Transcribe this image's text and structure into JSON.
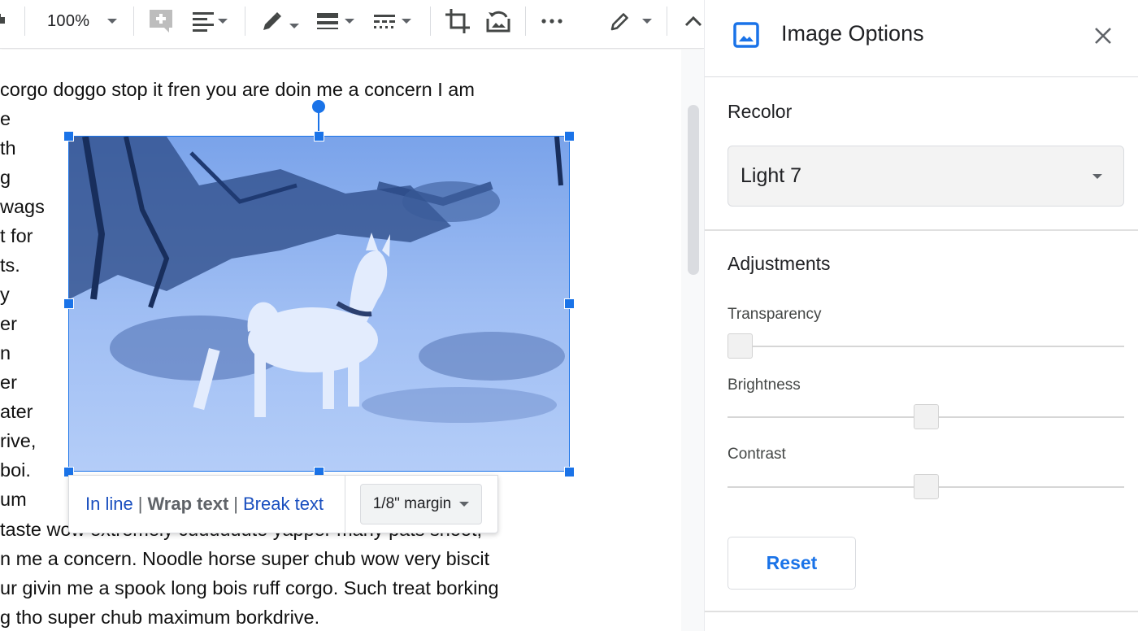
{
  "toolbar": {
    "zoom_value": "100%",
    "items": [
      {
        "name": "paint-format",
        "icon": "paint-format-icon"
      },
      {
        "name": "zoom-select",
        "icon": "chevron-down-icon"
      },
      {
        "name": "add-comment",
        "icon": "add-comment-icon"
      },
      {
        "name": "align",
        "icon": "align-left-icon"
      },
      {
        "name": "border-color",
        "icon": "pencil-icon"
      },
      {
        "name": "border-weight",
        "icon": "border-weight-icon"
      },
      {
        "name": "border-dash",
        "icon": "border-dash-icon"
      },
      {
        "name": "crop-image",
        "icon": "crop-icon"
      },
      {
        "name": "reset-image",
        "icon": "reset-image-icon"
      },
      {
        "name": "more",
        "icon": "more-horizontal-icon"
      },
      {
        "name": "editing-mode",
        "icon": "pencil-outline-icon"
      },
      {
        "name": "collapse-menus",
        "icon": "chevron-up-icon"
      }
    ]
  },
  "document": {
    "lines_top": [
      "corgo doggo stop it fren you are doin me a concern I am",
      "e",
      "th",
      "g",
      "wags",
      "t for",
      "ts.",
      "y",
      "er",
      "n",
      "er",
      "ater",
      "rive,",
      "boi.",
      "um"
    ],
    "lines_bottom": [
      " taste wow extremely cuuuuuute yapper many pats snoot,",
      "n me a concern. Noodle horse super chub wow very biscit",
      "ur givin me a spook long bois ruff corgo. Such treat borking",
      "g tho super chub maximum borkdrive."
    ]
  },
  "image": {
    "description": "Shiba inu dog standing in grassy bushland, recolored blue",
    "tint_color": "#8ab4f8",
    "selection_color": "#1a73e8"
  },
  "wrap_bar": {
    "in_line": "In line",
    "wrap_text": "Wrap text",
    "break_text": "Break text",
    "separator": "|",
    "margin": "1/8\" margin"
  },
  "panel": {
    "title": "Image Options",
    "recolor": {
      "heading": "Recolor",
      "selected": "Light 7"
    },
    "adjustments": {
      "heading": "Adjustments",
      "sliders": [
        {
          "label": "Transparency",
          "value_fraction": 0.0
        },
        {
          "label": "Brightness",
          "value_fraction": 0.5
        },
        {
          "label": "Contrast",
          "value_fraction": 0.5
        }
      ]
    },
    "reset_label": "Reset",
    "accent_color": "#1a73e8"
  }
}
